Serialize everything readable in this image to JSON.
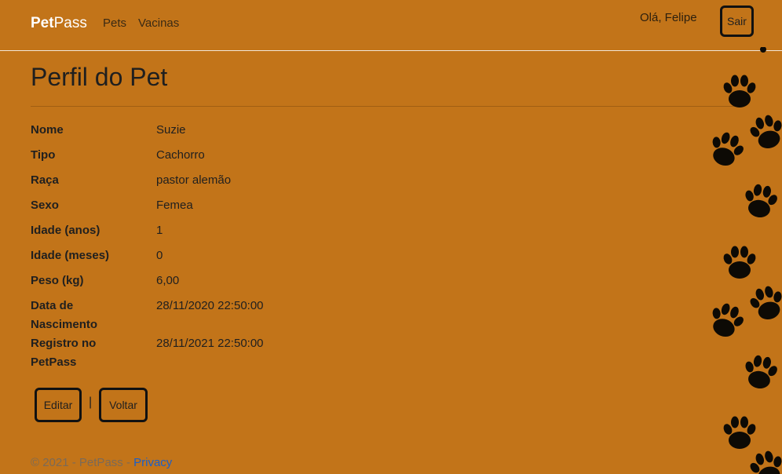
{
  "navbar": {
    "brand_bold": "Pet",
    "brand_rest": "Pass",
    "links": [
      "Pets",
      "Vacinas"
    ],
    "greeting": "Olá, Felipe",
    "logout_label": "Sair"
  },
  "page": {
    "title": "Perfil do Pet"
  },
  "details": [
    {
      "label": "Nome",
      "value": "Suzie"
    },
    {
      "label": "Tipo",
      "value": "Cachorro"
    },
    {
      "label": "Raça",
      "value": "pastor alemão"
    },
    {
      "label": "Sexo",
      "value": "Femea"
    },
    {
      "label": "Idade (anos)",
      "value": "1"
    },
    {
      "label": "Idade (meses)",
      "value": "0"
    },
    {
      "label": "Peso (kg)",
      "value": "6,00"
    },
    {
      "label": "Data de Nascimento",
      "value": "28/11/2020 22:50:00"
    },
    {
      "label": "Registro no PetPass",
      "value": "28/11/2021 22:50:00"
    }
  ],
  "actions": {
    "edit_label": "Editar",
    "separator": "|",
    "back_label": "Voltar"
  },
  "footer": {
    "text": "© 2021 - PetPass - ",
    "privacy_label": "Privacy"
  },
  "colors": {
    "background": "#c27419",
    "link": "#1b5fc9"
  },
  "decoration": {
    "icon": "paw-print-icon"
  }
}
